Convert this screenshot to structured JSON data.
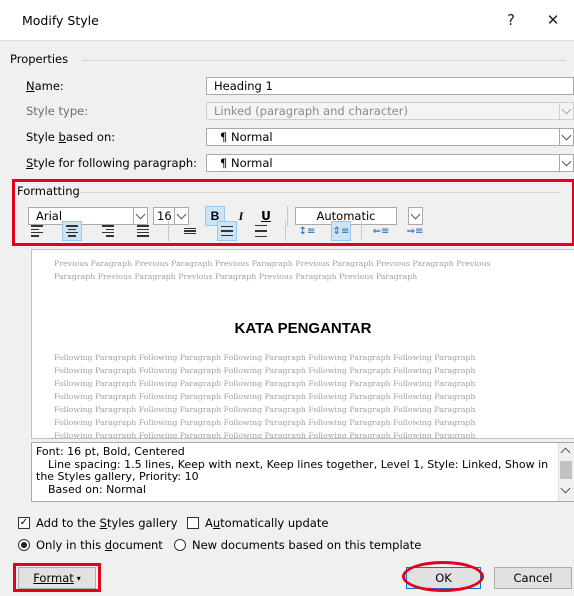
{
  "window": {
    "title": "Modify Style",
    "help_icon": "?",
    "close_icon": "✕"
  },
  "properties": {
    "group_label": "Properties",
    "name_label": "Name:",
    "name_value": "Heading 1",
    "style_type_label": "Style type:",
    "style_type_value": "Linked (paragraph and character)",
    "based_on_label": "Style based on:",
    "based_on_value": "Normal",
    "following_label": "Style for following paragraph:",
    "following_value": "Normal",
    "paragraph_mark": "¶"
  },
  "formatting": {
    "group_label": "Formatting",
    "font": "Arial",
    "size": "16",
    "bold": "B",
    "italic": "I",
    "underline": "U",
    "color": "Automatic"
  },
  "preview": {
    "previous_lines": [
      "Previous Paragraph Previous Paragraph Previous Paragraph Previous Paragraph Previous Paragraph Previous",
      "Paragraph Previous Paragraph Previous Paragraph Previous Paragraph Previous Paragraph"
    ],
    "heading": "KATA PENGANTAR",
    "following_line": "Following Paragraph Following Paragraph Following Paragraph Following Paragraph Following Paragraph"
  },
  "description": {
    "line1": "Font: 16 pt, Bold, Centered",
    "line2": "Line spacing:  1.5 lines, Keep with next, Keep lines together, Level 1, Style: Linked, Show in",
    "line3": "the Styles gallery, Priority: 10",
    "line4": "Based on: Normal"
  },
  "options": {
    "add_to_gallery": "Add to the Styles gallery",
    "auto_update": "Automatically update",
    "only_this_doc": "Only in this document",
    "new_docs": "New documents based on this template"
  },
  "buttons": {
    "format": "Format",
    "ok": "OK",
    "cancel": "Cancel"
  },
  "colors": {
    "highlight_red": "#e3001b",
    "active_blue": "#cde4f7"
  }
}
